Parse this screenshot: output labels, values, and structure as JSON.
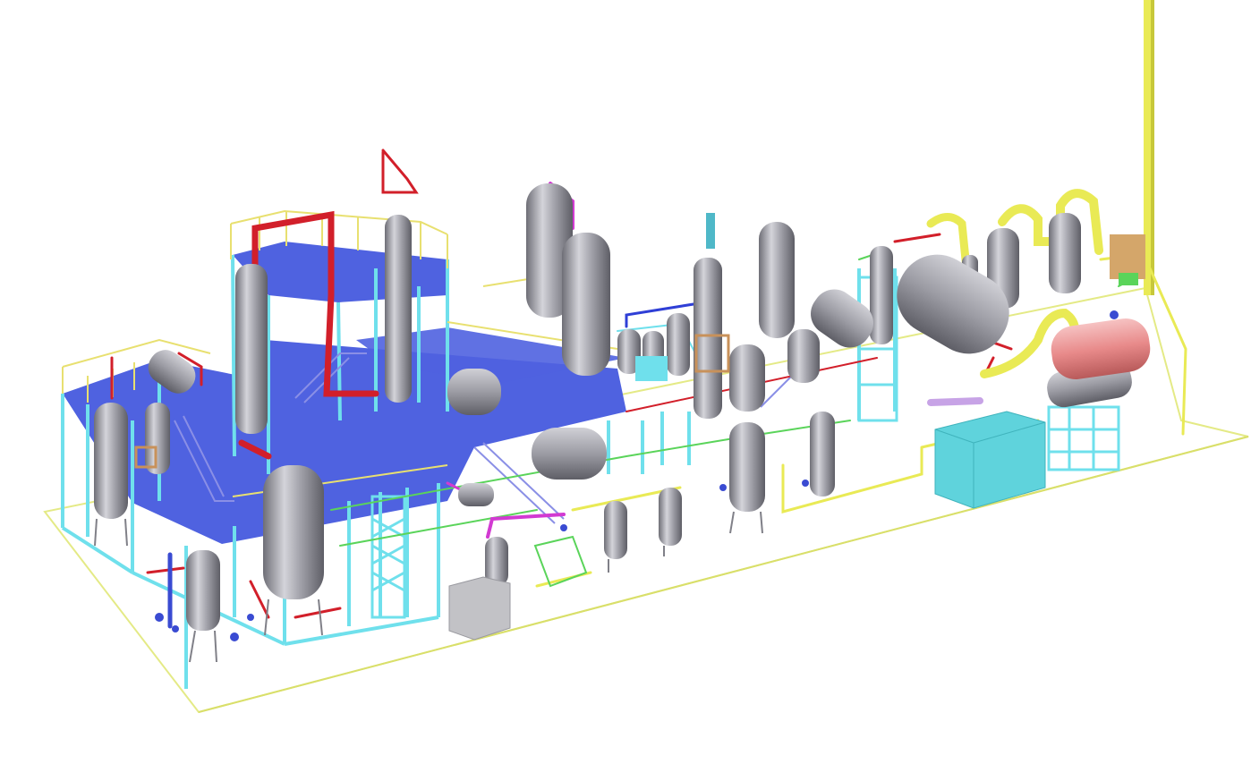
{
  "scene": {
    "background": "#ffffff",
    "colors": {
      "footprint": "#e4ea86",
      "deck": "#4f62e0",
      "steel": "#6fe0ec",
      "railing": "#e8e070",
      "vessel_light": "#c6c6cc",
      "vessel_mid": "#9c9ca4",
      "vessel_dark": "#6e6e76",
      "pipe_red": "#d21f2a",
      "pipe_yellow": "#e9ea55",
      "pipe_green": "#5ad45a",
      "pipe_magenta": "#d23ad2",
      "pipe_blue": "#2f3fd6",
      "pipe_lavender": "#c7a3e6",
      "heater": "#e88a8a",
      "control_box": "#5fd3dc",
      "control_panel": "#c2c2c6",
      "valve": "#3a4bd2",
      "frame_tan": "#c8915a"
    }
  }
}
